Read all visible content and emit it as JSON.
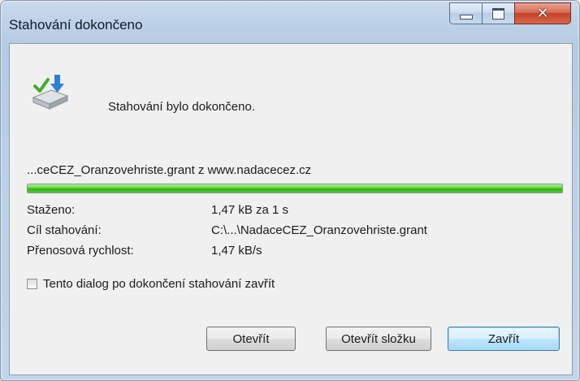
{
  "window": {
    "title": "Stahování dokončeno"
  },
  "icon": "download-complete-icon",
  "message": "Stahování bylo dokončeno.",
  "file_label": "...ceCEZ_Oranzovehriste.grant z www.nadacecez.cz",
  "progress": {
    "percent": 100,
    "color": "#2cb214"
  },
  "details": [
    {
      "label": "Staženo:",
      "value": "1,47 kB za 1 s"
    },
    {
      "label": "Cíl stahování:",
      "value": "C:\\...\\NadaceCEZ_Oranzovehriste.grant"
    },
    {
      "label": "Přenosová rychlost:",
      "value": "1,47 kB/s"
    }
  ],
  "close_on_complete": {
    "label": "Tento dialog po dokončení stahování zavřít",
    "checked": false
  },
  "buttons": {
    "open": "Otevřít",
    "open_folder": "Otevřít složku",
    "close": "Zavřít"
  }
}
